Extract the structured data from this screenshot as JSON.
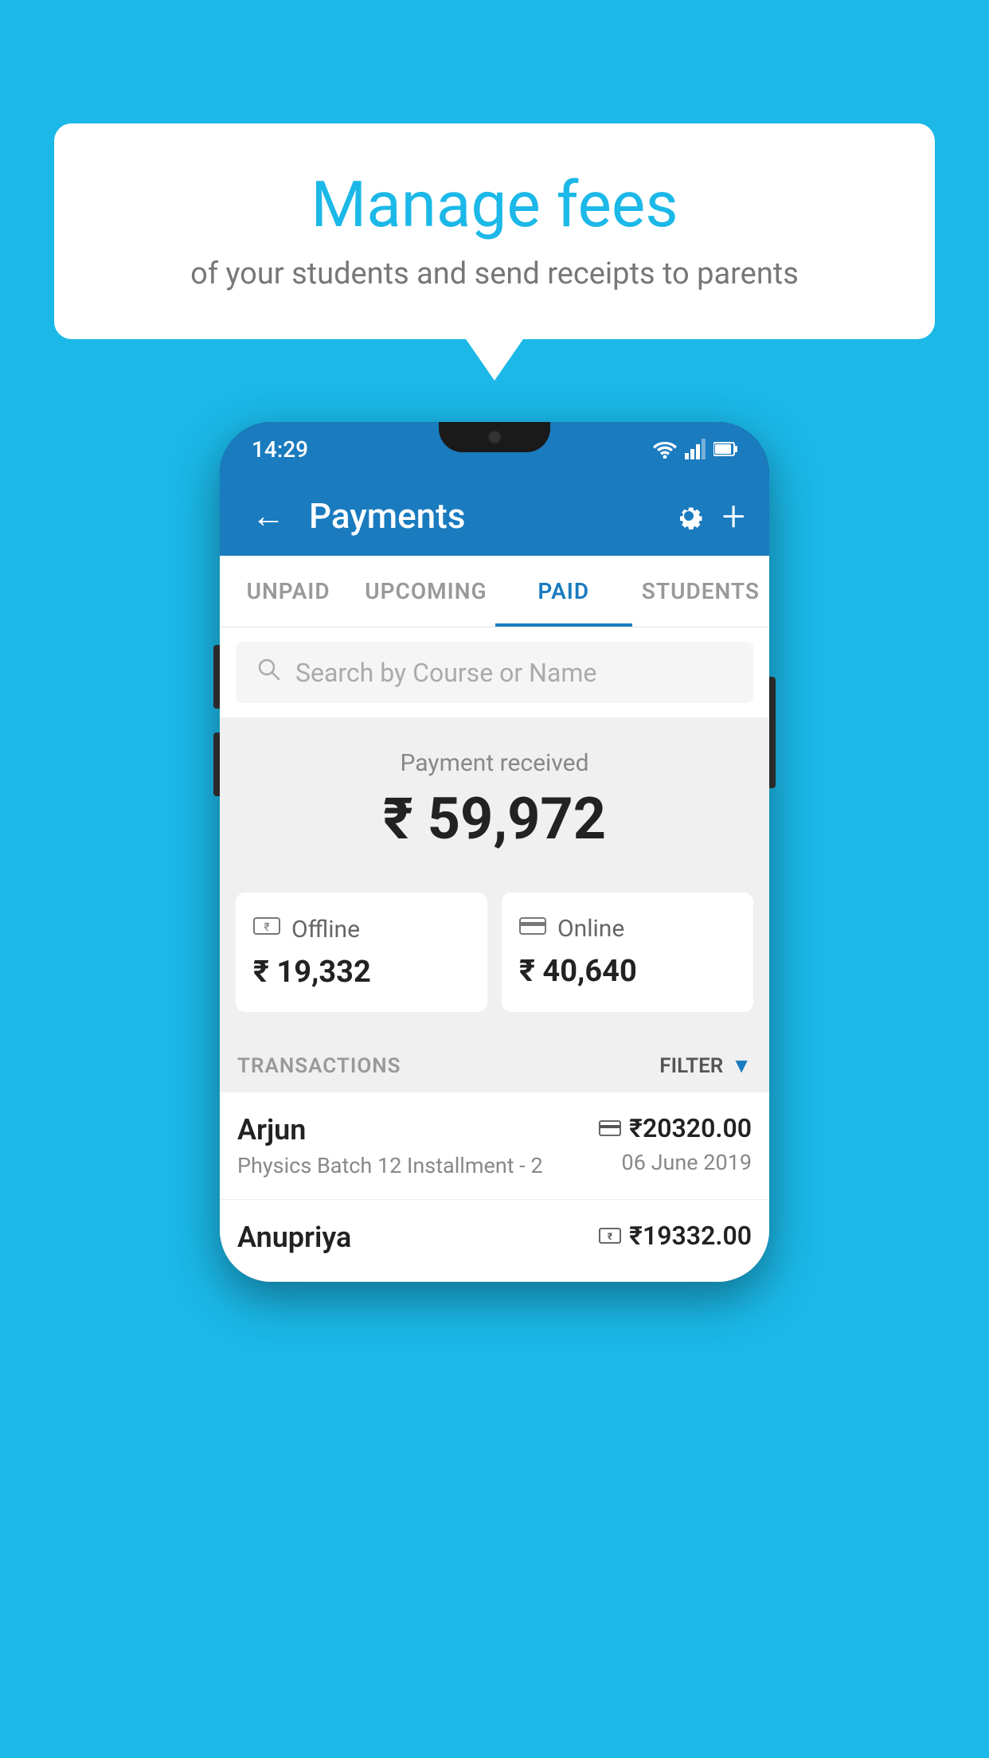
{
  "page": {
    "background_color": "#1bb8e8"
  },
  "speech_bubble": {
    "title": "Manage fees",
    "subtitle": "of your students and send receipts to parents"
  },
  "status_bar": {
    "time": "14:29",
    "wifi_icon": "wifi",
    "signal_icon": "signal",
    "battery_icon": "battery"
  },
  "app_bar": {
    "title": "Payments",
    "back_label": "←",
    "settings_label": "⚙",
    "add_label": "+"
  },
  "tabs": [
    {
      "label": "UNPAID",
      "active": false
    },
    {
      "label": "UPCOMING",
      "active": false
    },
    {
      "label": "PAID",
      "active": true
    },
    {
      "label": "STUDENTS",
      "active": false
    }
  ],
  "search": {
    "placeholder": "Search by Course or Name"
  },
  "payment_summary": {
    "label": "Payment received",
    "total": "₹ 59,972",
    "offline_label": "Offline",
    "offline_amount": "₹ 19,332",
    "online_label": "Online",
    "online_amount": "₹ 40,640"
  },
  "transactions": {
    "header_label": "TRANSACTIONS",
    "filter_label": "FILTER",
    "items": [
      {
        "name": "Arjun",
        "detail": "Physics Batch 12 Installment - 2",
        "amount": "₹20320.00",
        "date": "06 June 2019",
        "payment_type": "online"
      },
      {
        "name": "Anupriya",
        "detail": "",
        "amount": "₹19332.00",
        "date": "",
        "payment_type": "offline"
      }
    ]
  }
}
